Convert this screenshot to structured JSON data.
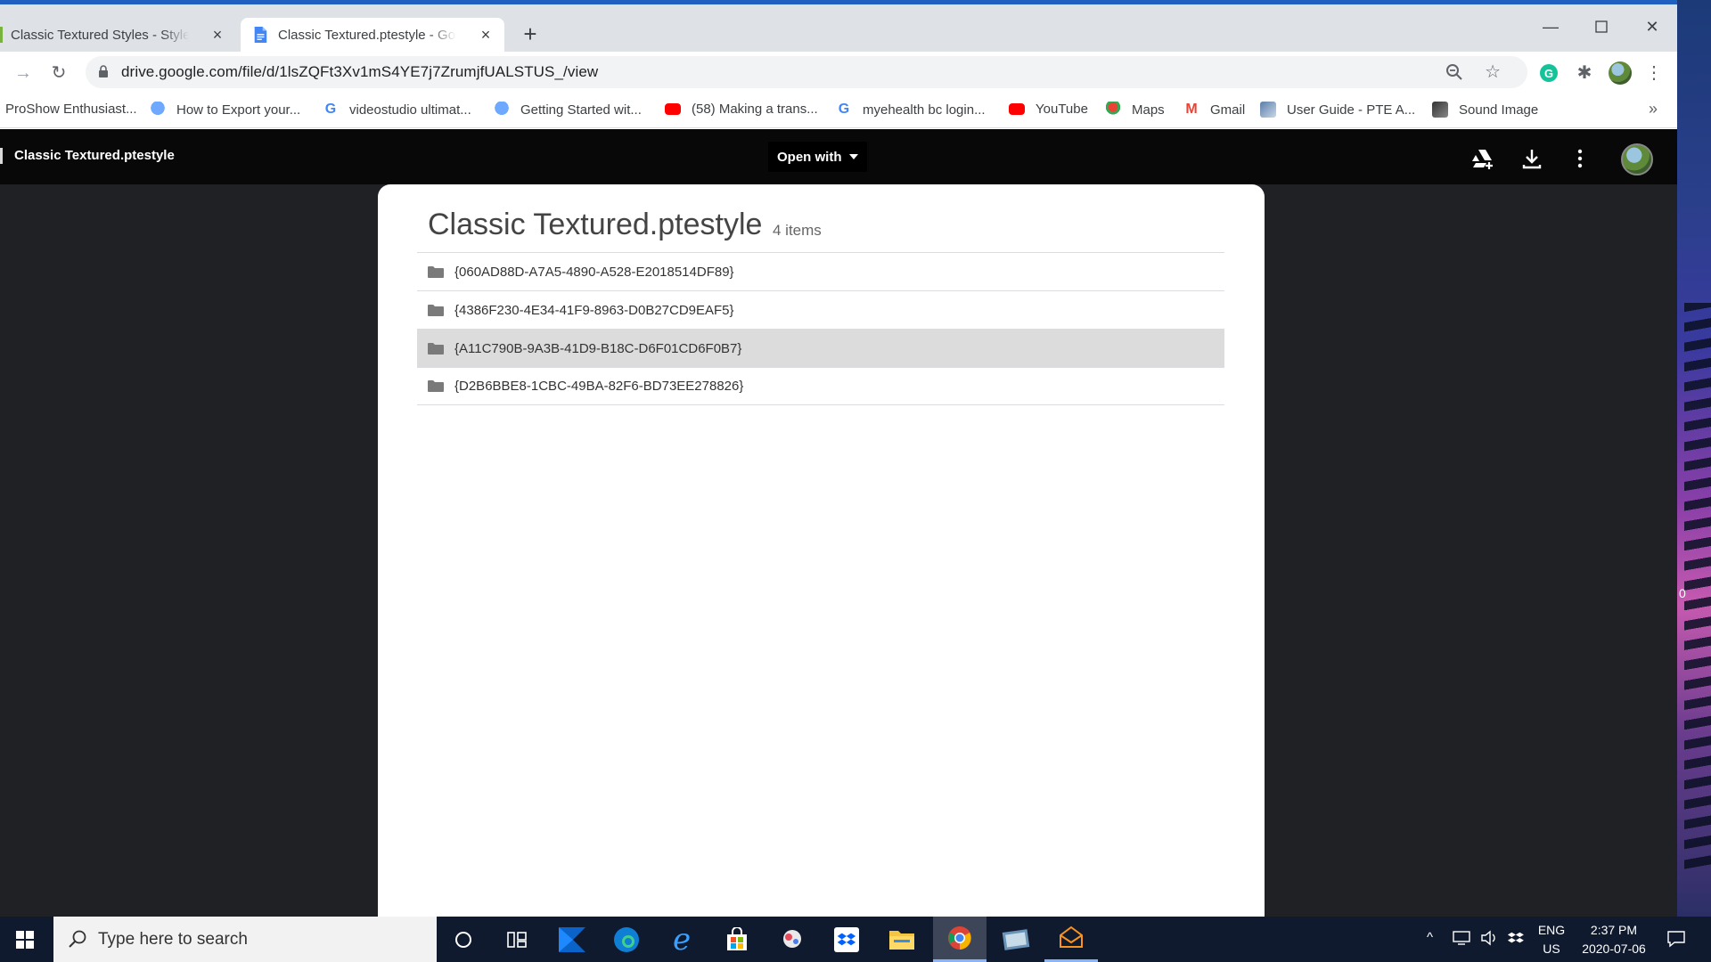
{
  "browser": {
    "tabs": [
      {
        "title": "Classic Textured Styles - Styles & ",
        "active": false
      },
      {
        "title": "Classic Textured.ptestyle - Google",
        "active": true
      }
    ],
    "url": "drive.google.com/file/d/1lsZQFt3Xv1mS4YE7j7ZrumjfUALSTUS_/view",
    "bookmarks": [
      {
        "label": "ProShow Enthusiast...",
        "icon": "none"
      },
      {
        "label": "How to Export your...",
        "icon": "balloon-icon"
      },
      {
        "label": "videostudio ultimat...",
        "icon": "google-icon"
      },
      {
        "label": "Getting Started wit...",
        "icon": "balloon-icon"
      },
      {
        "label": "(58) Making a trans...",
        "icon": "youtube-icon"
      },
      {
        "label": "myehealth bc login...",
        "icon": "google-icon"
      },
      {
        "label": "YouTube",
        "icon": "youtube-icon"
      },
      {
        "label": "Maps",
        "icon": "maps-icon"
      },
      {
        "label": "Gmail",
        "icon": "gmail-icon"
      },
      {
        "label": "User Guide - PTE A...",
        "icon": "image-icon"
      },
      {
        "label": "Sound Image",
        "icon": "image-icon"
      }
    ],
    "bookmarks_overflow": "»"
  },
  "viewer": {
    "file_name": "Classic Textured.ptestyle",
    "open_with_label": "Open with"
  },
  "archive": {
    "title": "Classic Textured.ptestyle",
    "count": "4 items",
    "items": [
      {
        "name": "{060AD88D-A7A5-4890-A528-E2018514DF89}",
        "selected": false
      },
      {
        "name": "{4386F230-4E34-41F9-8963-D0B27CD9EAF5}",
        "selected": false
      },
      {
        "name": "{A11C790B-9A3B-41D9-B18C-D6F01CD6F0B7}",
        "selected": true
      },
      {
        "name": "{D2B6BBE8-1CBC-49BA-82F6-BD73EE278826}",
        "selected": false
      }
    ]
  },
  "taskbar": {
    "search_placeholder": "Type here to search",
    "lang_top": "ENG",
    "lang_bottom": "US",
    "time": "2:37 PM",
    "date": "2020-07-06"
  },
  "desktop": {
    "edge_text": "0"
  },
  "colors": {
    "accent": "#1a73e8",
    "viewer_bg": "#202124",
    "taskbar_bg": "#101a2e"
  }
}
